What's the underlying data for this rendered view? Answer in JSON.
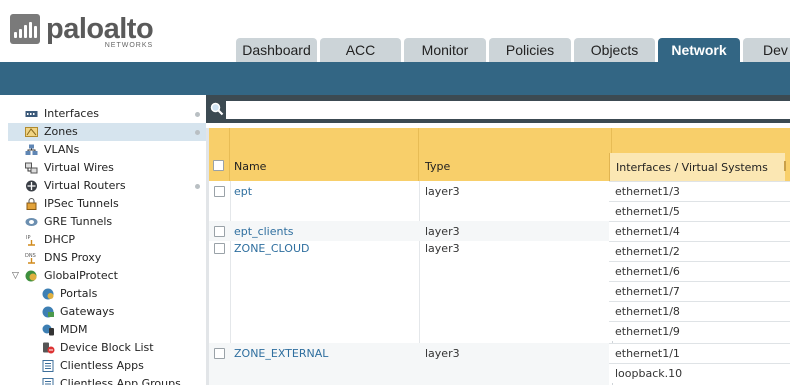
{
  "brand": {
    "name": "paloalto",
    "sub": "NETWORKS"
  },
  "tabs": [
    "Dashboard",
    "ACC",
    "Monitor",
    "Policies",
    "Objects",
    "Network",
    "Dev"
  ],
  "active_tab": "Network",
  "sidebar": {
    "items": [
      {
        "label": "Interfaces",
        "icon": "interfaces-icon"
      },
      {
        "label": "Zones",
        "icon": "zones-icon"
      },
      {
        "label": "VLANs",
        "icon": "vlans-icon"
      },
      {
        "label": "Virtual Wires",
        "icon": "virtual-wires-icon"
      },
      {
        "label": "Virtual Routers",
        "icon": "virtual-routers-icon"
      },
      {
        "label": "IPSec Tunnels",
        "icon": "ipsec-tunnels-icon"
      },
      {
        "label": "GRE Tunnels",
        "icon": "gre-tunnels-icon"
      },
      {
        "label": "DHCP",
        "icon": "dhcp-icon"
      },
      {
        "label": "DNS Proxy",
        "icon": "dns-proxy-icon"
      },
      {
        "label": "GlobalProtect",
        "icon": "globalprotect-icon"
      },
      {
        "label": "Portals",
        "icon": "portals-icon"
      },
      {
        "label": "Gateways",
        "icon": "gateways-icon"
      },
      {
        "label": "MDM",
        "icon": "mdm-icon"
      },
      {
        "label": "Device Block List",
        "icon": "device-block-list-icon"
      },
      {
        "label": "Clientless Apps",
        "icon": "clientless-apps-icon"
      },
      {
        "label": "Clientless App Groups",
        "icon": "clientless-app-groups-icon"
      }
    ]
  },
  "search": {
    "value": "",
    "placeholder": ""
  },
  "table": {
    "columns": {
      "name": "Name",
      "type": "Type",
      "interfaces": "Interfaces / Virtual Systems"
    },
    "rows": [
      {
        "name": "ept",
        "type": "layer3",
        "interfaces": [
          "ethernet1/3",
          "ethernet1/5"
        ]
      },
      {
        "name": "ept_clients",
        "type": "layer3",
        "interfaces": [
          "ethernet1/4"
        ]
      },
      {
        "name": "ZONE_CLOUD",
        "type": "layer3",
        "interfaces": [
          "ethernet1/2",
          "ethernet1/6",
          "ethernet1/7",
          "ethernet1/8",
          "ethernet1/9"
        ]
      },
      {
        "name": "ZONE_EXTERNAL",
        "type": "layer3",
        "interfaces": [
          "ethernet1/1",
          "loopback.10"
        ]
      }
    ]
  },
  "colors": {
    "accent": "#336684",
    "header": "#f8cf6a",
    "link": "#2f6f9f"
  }
}
